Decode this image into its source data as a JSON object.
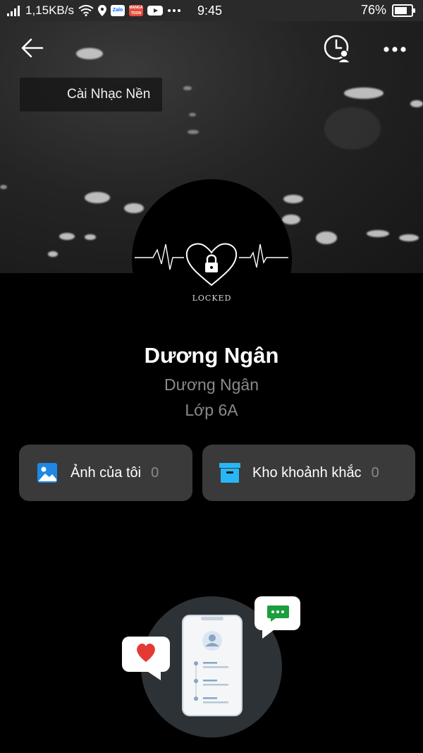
{
  "status_bar": {
    "net_speed": "1,15KB/s",
    "apps": [
      "Zalo",
      "MANGA TOON"
    ],
    "time": "9:45",
    "battery": "76%"
  },
  "header": {
    "back_icon": "arrow-left-icon",
    "history_icon": "clock-person-icon",
    "more_icon": "more-dots-icon",
    "music_label": "Cài Nhạc Nền"
  },
  "avatar": {
    "caption": "LOCKED"
  },
  "profile": {
    "name": "Dương Ngân",
    "subname": "Dương Ngân",
    "class": "Lớp 6A"
  },
  "cards": {
    "photos": {
      "label": "Ảnh của tôi",
      "count": "0",
      "icon_color": "#1e88e5"
    },
    "moments": {
      "label": "Kho khoảnh khắc",
      "count": "0",
      "icon_color": "#29b6f6"
    }
  }
}
